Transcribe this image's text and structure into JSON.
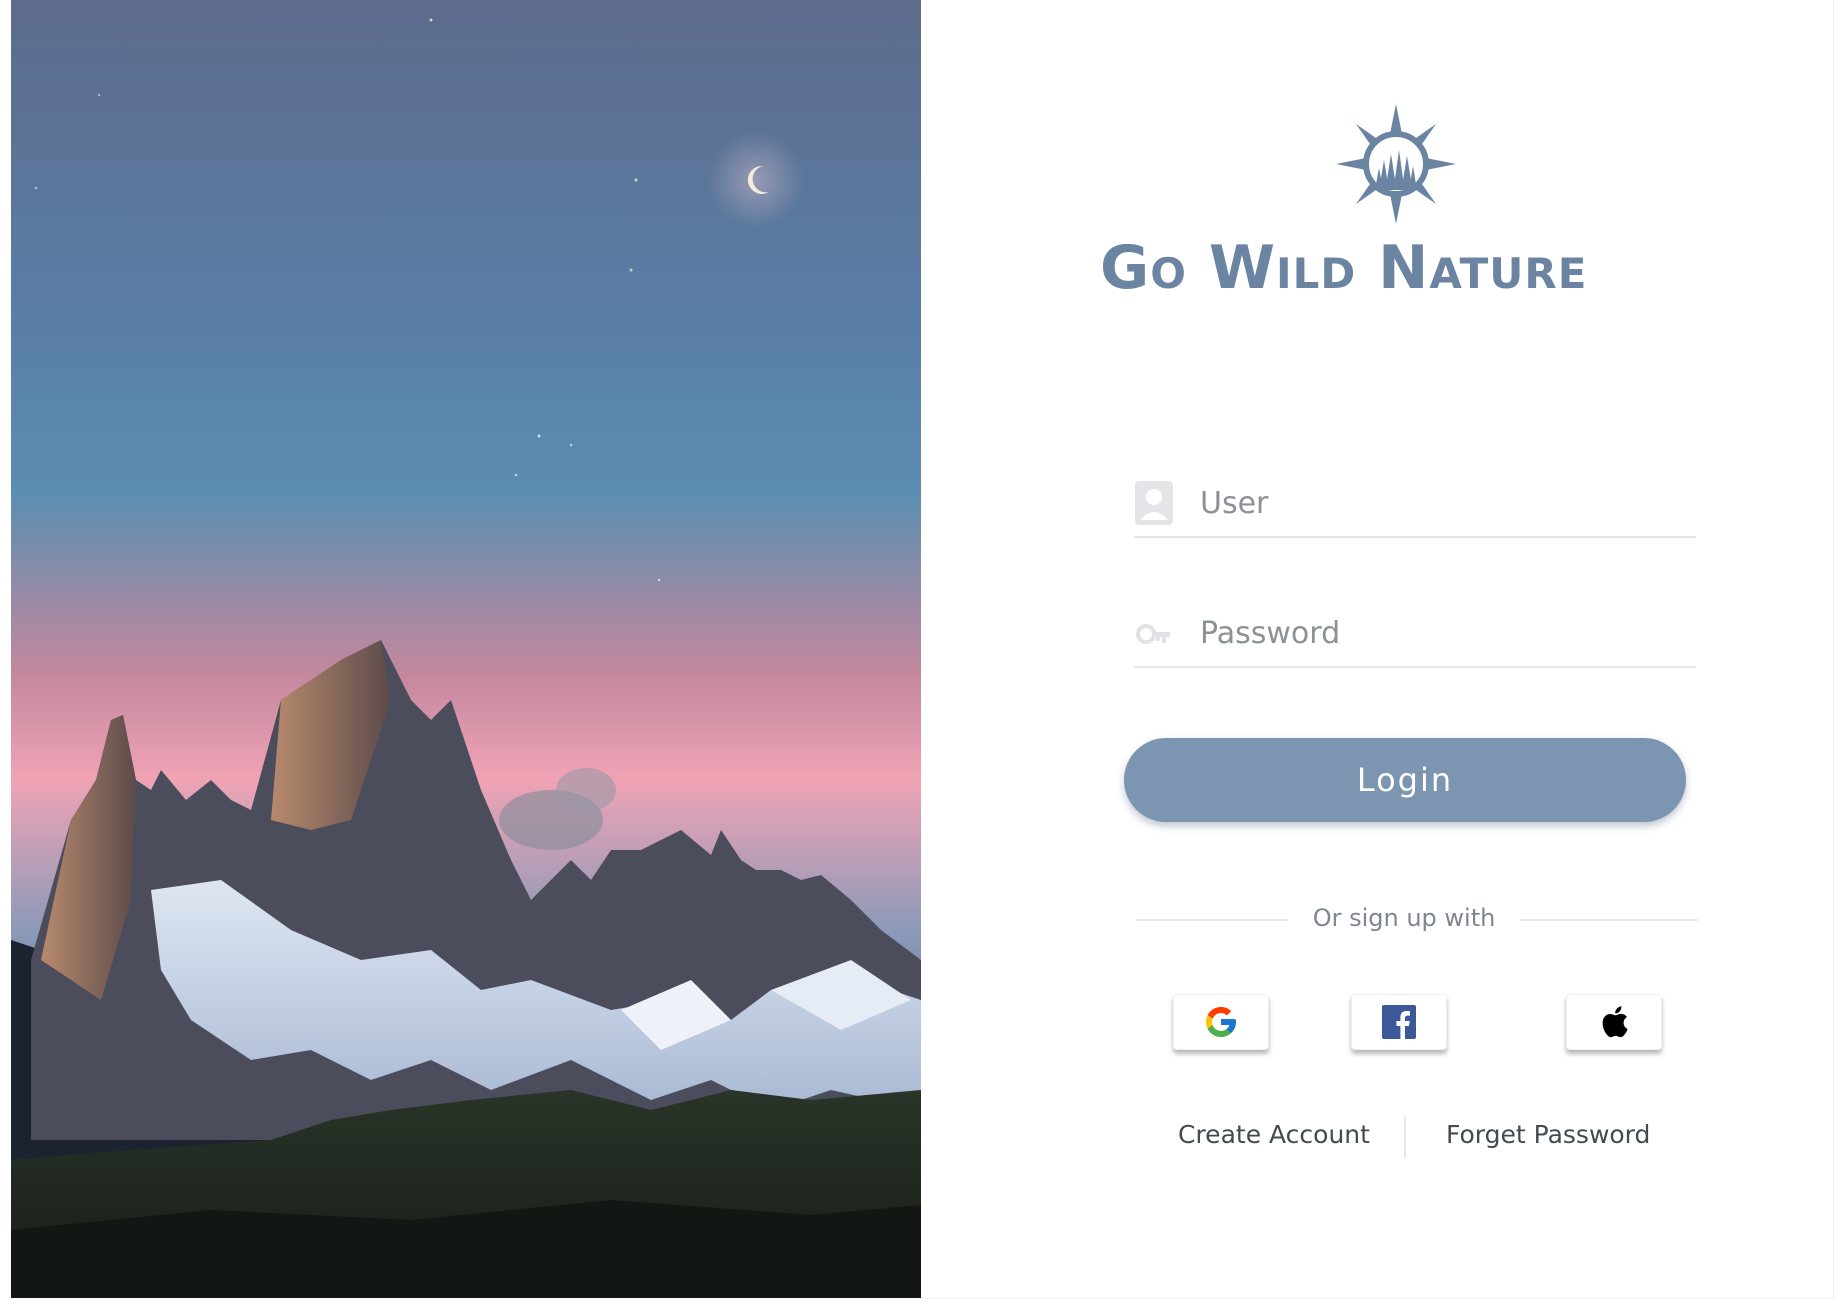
{
  "brand": {
    "name": "Go Wild Nature",
    "logo_icon": "compass-pine-trees-icon",
    "color": "#6b84a2"
  },
  "login_form": {
    "user_field": {
      "placeholder": "User",
      "value": "",
      "icon": "user-avatar-icon"
    },
    "password_field": {
      "placeholder": "Password",
      "value": "",
      "icon": "key-icon"
    },
    "login_button_label": "Login",
    "login_button_color": "#7c95b1"
  },
  "social": {
    "divider_text": "Or sign up with",
    "providers": [
      {
        "name": "google",
        "icon": "google-icon"
      },
      {
        "name": "facebook",
        "icon": "facebook-icon"
      },
      {
        "name": "apple",
        "icon": "apple-icon"
      }
    ]
  },
  "footer_links": {
    "create_account": "Create Account",
    "forget_password": "Forget Password"
  },
  "hero": {
    "image": "mountain-peaks-at-dusk-with-crescent-moon"
  }
}
